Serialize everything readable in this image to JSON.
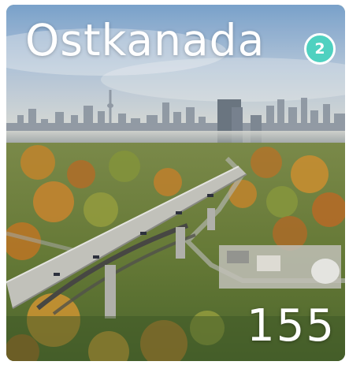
{
  "card": {
    "title": "Ostkanada",
    "badge": "2",
    "count": "155",
    "image": "city-skyline-autumn-bridge",
    "colors": {
      "badge": "#4fd1c0",
      "text": "#ffffff"
    }
  }
}
